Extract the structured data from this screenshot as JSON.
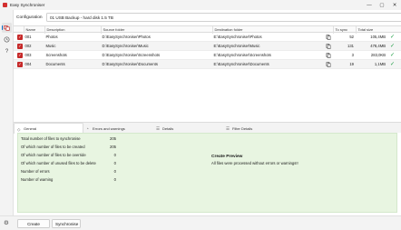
{
  "window": {
    "title": "Easy Synchroniser",
    "controls": {
      "minimize": "—",
      "maximize": "▢",
      "close": "✕"
    }
  },
  "sidebar": {
    "items": [
      {
        "icon": "sync-icon",
        "active": true
      },
      {
        "icon": "history-icon",
        "active": false
      },
      {
        "icon": "help-icon",
        "active": false
      }
    ]
  },
  "config": {
    "label": "Configuration",
    "value": "01 USB Backup - hard disk 1.5 TB"
  },
  "table": {
    "columns": [
      "Name",
      "Description",
      "Source folder",
      "Destination folder",
      "To sync",
      "Total size"
    ],
    "rows": [
      {
        "name": "001",
        "description": "Photos",
        "source": "D:\\EasySynchroniser\\Photos",
        "destination": "E:\\EasySynchroniser\\Photos",
        "to_sync": "52",
        "total_size": "105,4MB",
        "checked": true,
        "status": "ok",
        "row_icon": "copy-icon"
      },
      {
        "name": "002",
        "description": "Music",
        "source": "D:\\EasySynchroniser\\Music",
        "destination": "E:\\EasySynchroniser\\Music",
        "to_sync": "131",
        "total_size": "478,4MB",
        "checked": true,
        "status": "ok",
        "row_icon": "copy-icon"
      },
      {
        "name": "003",
        "description": "Screenshots",
        "source": "D:\\EasySynchroniser\\Screenshots",
        "destination": "E:\\EasySynchroniser\\Screenshots",
        "to_sync": "3",
        "total_size": "283,0KB",
        "checked": true,
        "status": "ok",
        "row_icon": "copy-icon"
      },
      {
        "name": "004",
        "description": "Documents",
        "source": "D:\\EasySynchroniser\\Documents",
        "destination": "E:\\EasySynchroniser\\Documents",
        "to_sync": "19",
        "total_size": "1,1MB",
        "checked": true,
        "status": "ok",
        "row_icon": "copy-delete-icon"
      }
    ]
  },
  "tabs": [
    {
      "label": "General",
      "icon": "info-icon",
      "active": true
    },
    {
      "label": "Errors and warnings",
      "icon": "warning-icon",
      "active": false
    },
    {
      "label": "Details",
      "icon": "list-icon",
      "active": false
    },
    {
      "label": "Filter Details",
      "icon": "filter-icon",
      "active": false
    }
  ],
  "stats": [
    {
      "label": "Total number of files to synchronise",
      "value": "205"
    },
    {
      "label": "Of which number of files to be created",
      "value": "205"
    },
    {
      "label": "Of which number of files to be override",
      "value": "0"
    },
    {
      "label": "Of which number of unused files to be delete",
      "value": "0"
    },
    {
      "label": "Number of errors",
      "value": "0"
    },
    {
      "label": "Number of warning",
      "value": "0"
    }
  ],
  "preview": {
    "title": "Create Preview",
    "subtitle": "All files were processed without errors or warnings!!"
  },
  "actions": {
    "create_preview": "Create Preview",
    "synchronise": "Synchronise"
  },
  "colors": {
    "accent": "#0067c0",
    "checkbox": "#c62828",
    "ok": "#1e9e44",
    "panel": "#e8f5e1"
  }
}
